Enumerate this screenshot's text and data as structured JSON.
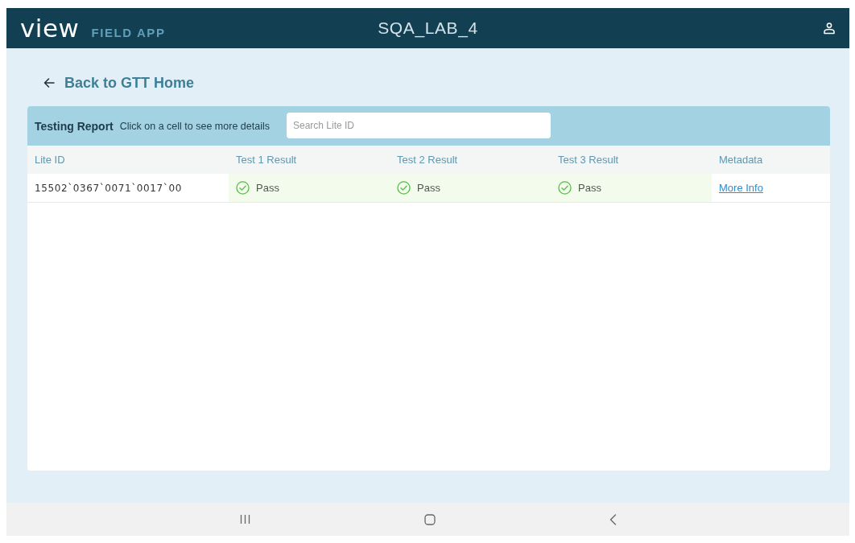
{
  "header": {
    "logo": "view",
    "app_name": "FIELD APP",
    "title": "SQA_LAB_4"
  },
  "back_link": "Back to GTT Home",
  "report": {
    "title": "Testing Report",
    "hint": "Click on a cell to see more details",
    "search": {
      "placeholder": "Search Lite ID"
    },
    "columns": [
      "Lite ID",
      "Test 1 Result",
      "Test 2 Result",
      "Test 3 Result",
      "Metadata"
    ],
    "rows": [
      {
        "lite_id": "15502`0367`0071`0017`00",
        "results": [
          {
            "kind": "pass",
            "label": "Pass"
          },
          {
            "kind": "pass",
            "label": "Pass"
          },
          {
            "kind": "pass",
            "label": "Pass"
          }
        ],
        "metadata_link": "More Info"
      }
    ]
  }
}
